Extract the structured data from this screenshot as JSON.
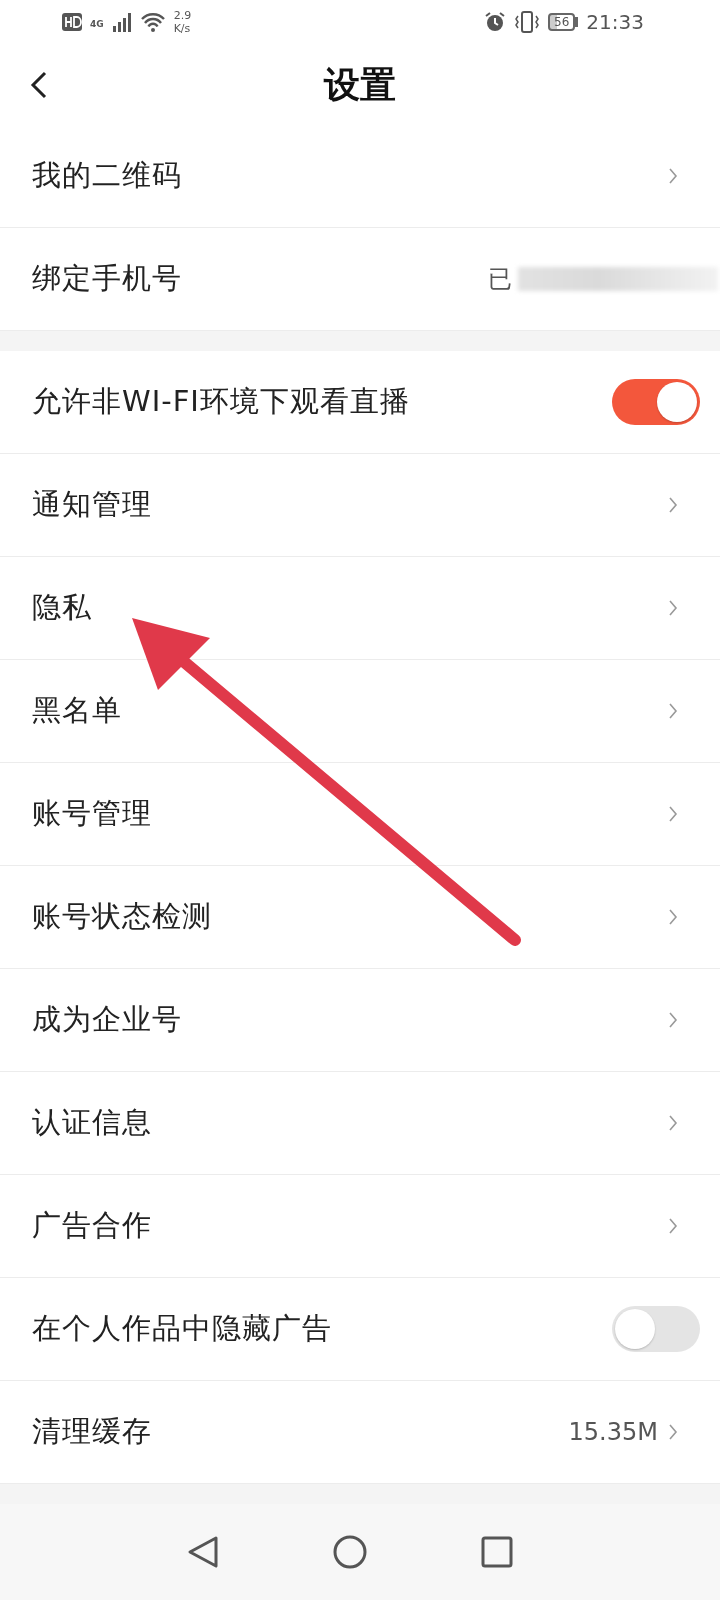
{
  "status_bar": {
    "network": "4G",
    "speed": "2.9",
    "speed_unit": "K/s",
    "battery": "56",
    "time": "21:33"
  },
  "header": {
    "title": "设置"
  },
  "groups": [
    {
      "rows": [
        {
          "kind": "link",
          "label": "我的二维码"
        },
        {
          "kind": "value",
          "label": "绑定手机号",
          "value": "已",
          "blurred": true
        }
      ]
    },
    {
      "rows": [
        {
          "kind": "toggle",
          "label": "允许非WI-FI环境下观看直播",
          "on": true
        },
        {
          "kind": "link",
          "label": "通知管理"
        },
        {
          "kind": "link",
          "label": "隐私"
        },
        {
          "kind": "link",
          "label": "黑名单"
        },
        {
          "kind": "link",
          "label": "账号管理"
        },
        {
          "kind": "link",
          "label": "账号状态检测"
        },
        {
          "kind": "link",
          "label": "成为企业号"
        },
        {
          "kind": "link",
          "label": "认证信息"
        },
        {
          "kind": "link",
          "label": "广告合作"
        },
        {
          "kind": "toggle",
          "label": "在个人作品中隐藏广告",
          "on": false
        },
        {
          "kind": "value",
          "label": "清理缓存",
          "value": "15.35M",
          "blurred": false
        }
      ]
    }
  ]
}
